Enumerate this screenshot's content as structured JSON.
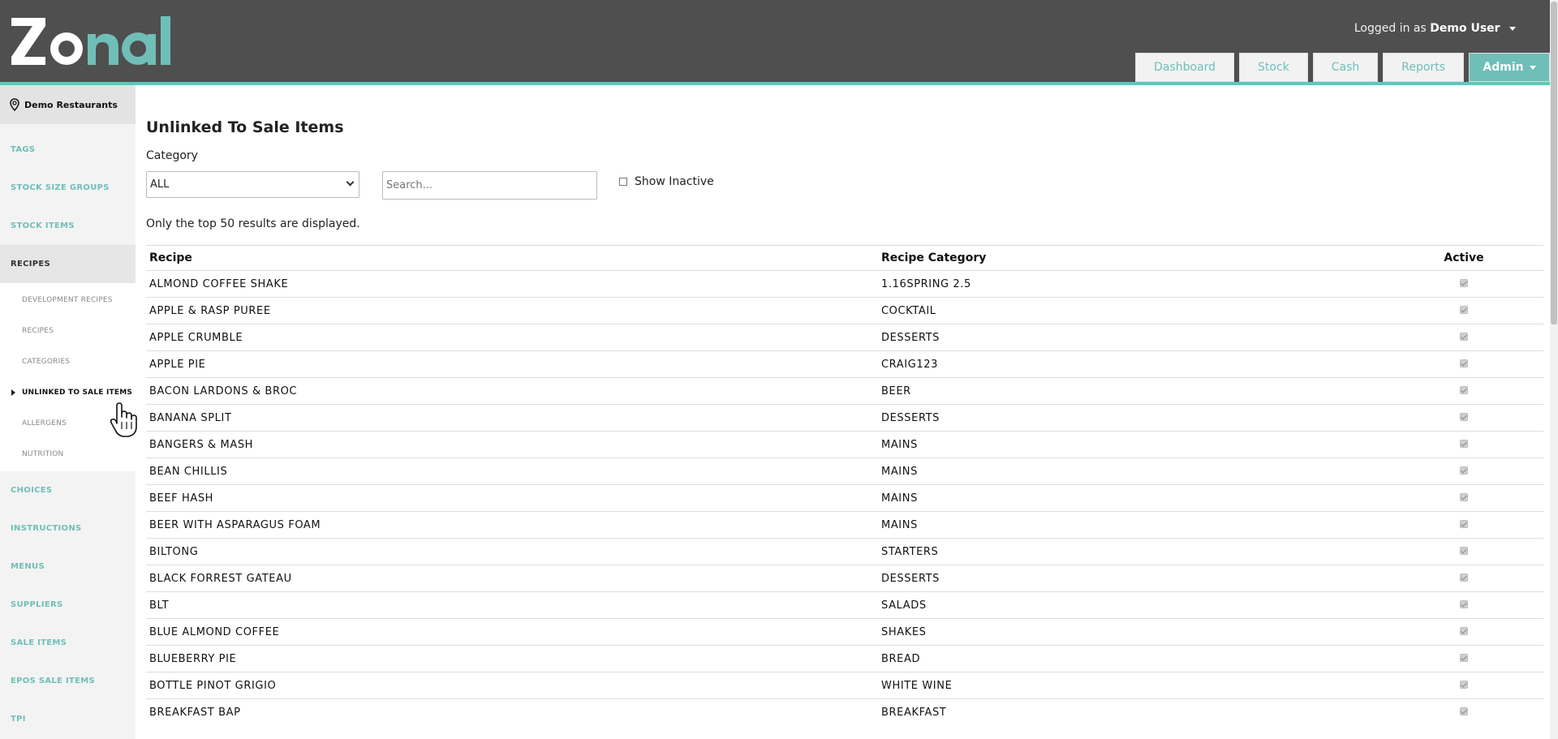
{
  "brand": {
    "name": "Zonal",
    "accent": "#6fbfb8",
    "header_bg": "#4f4f4f"
  },
  "user": {
    "prefix": "Logged in as",
    "name": "Demo User"
  },
  "nav": [
    {
      "label": "Dashboard"
    },
    {
      "label": "Stock"
    },
    {
      "label": "Cash"
    },
    {
      "label": "Reports"
    },
    {
      "label": "Admin"
    }
  ],
  "sidebar": {
    "location": "Demo Restaurants",
    "items_top": [
      "TAGS",
      "STOCK SIZE GROUPS",
      "STOCK ITEMS",
      "RECIPES"
    ],
    "sub_items": [
      "DEVELOPMENT RECIPES",
      "RECIPES",
      "CATEGORIES",
      "UNLINKED TO SALE ITEMS",
      "ALLERGENS",
      "NUTRITION"
    ],
    "items_bottom": [
      "CHOICES",
      "INSTRUCTIONS",
      "MENUS",
      "SUPPLIERS",
      "SALE ITEMS",
      "EPOS SALE ITEMS",
      "TPI"
    ]
  },
  "page": {
    "title": "Unlinked To Sale Items",
    "category_label": "Category",
    "category_value": "ALL",
    "search_placeholder": "Search...",
    "show_inactive_label": "Show Inactive",
    "note": "Only the top 50 results are displayed."
  },
  "table": {
    "headers": [
      "Recipe",
      "Recipe Category",
      "Active"
    ],
    "rows": [
      [
        "ALMOND COFFEE SHAKE",
        "1.16SPRING 2.5"
      ],
      [
        "APPLE & RASP PUREE",
        "COCKTAIL"
      ],
      [
        "APPLE CRUMBLE",
        "DESSERTS"
      ],
      [
        "APPLE PIE",
        "CRAIG123"
      ],
      [
        "BACON LARDONS & BROC",
        "BEER"
      ],
      [
        "BANANA SPLIT",
        "DESSERTS"
      ],
      [
        "BANGERS & MASH",
        "MAINS"
      ],
      [
        "BEAN CHILLIS",
        "MAINS"
      ],
      [
        "BEEF HASH",
        "MAINS"
      ],
      [
        "BEER WITH ASPARAGUS FOAM",
        "MAINS"
      ],
      [
        "BILTONG",
        "STARTERS"
      ],
      [
        "BLACK FORREST GATEAU",
        "DESSERTS"
      ],
      [
        "BLT",
        "SALADS"
      ],
      [
        "BLUE ALMOND COFFEE",
        "SHAKES"
      ],
      [
        "BLUEBERRY PIE",
        "BREAD"
      ],
      [
        "BOTTLE PINOT GRIGIO",
        "WHITE WINE"
      ],
      [
        "BREAKFAST BAP",
        "BREAKFAST"
      ]
    ]
  }
}
